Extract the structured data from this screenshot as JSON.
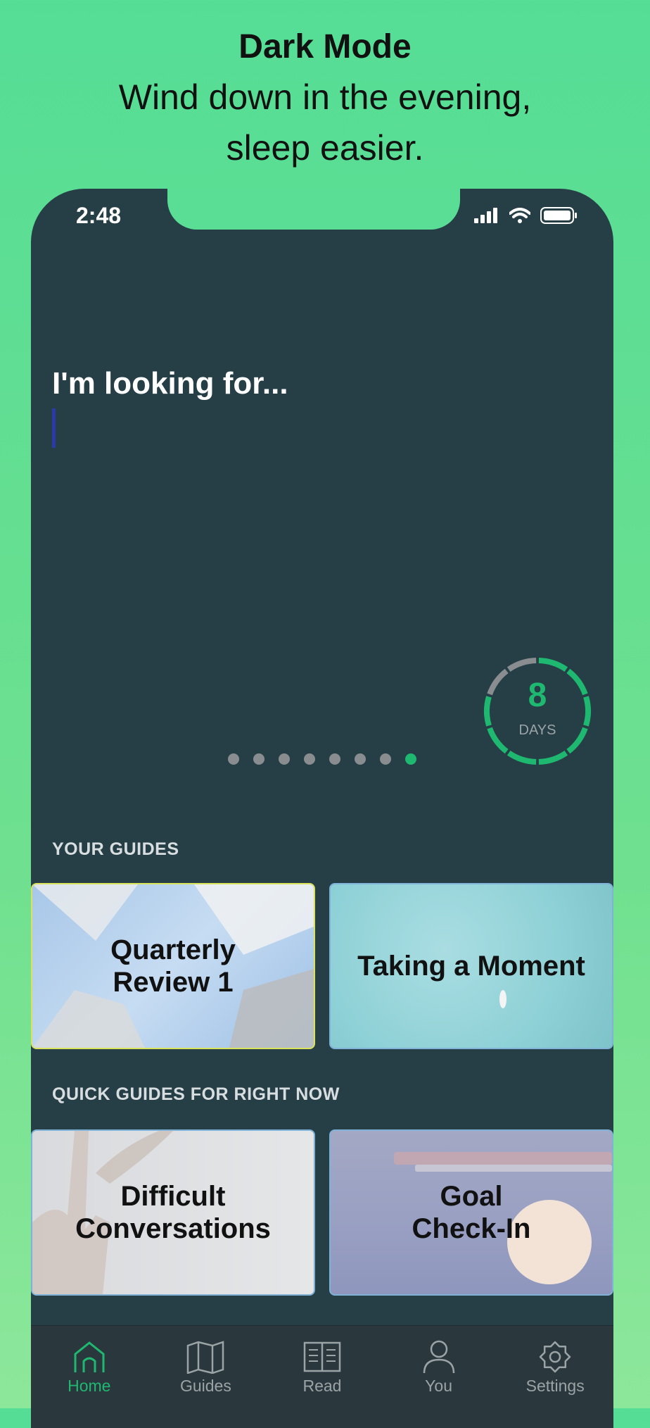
{
  "promo": {
    "title": "Dark Mode",
    "subtitle_line1": "Wind down in the evening,",
    "subtitle_line2": "sleep easier."
  },
  "status_bar": {
    "time": "2:48"
  },
  "search": {
    "prompt": "I'm looking for..."
  },
  "streak": {
    "count": "8",
    "label": "DAYS",
    "progress_fraction": 0.8
  },
  "carousel": {
    "page_count": 8,
    "active_index": 7
  },
  "your_guides": {
    "header": "YOUR GUIDES",
    "cards": [
      {
        "line1": "Quarterly",
        "line2": "Review 1"
      },
      {
        "line1": "Taking a Moment",
        "line2": ""
      }
    ]
  },
  "quick_guides": {
    "header": "QUICK GUIDES FOR RIGHT NOW",
    "cards": [
      {
        "line1": "Difficult",
        "line2": "Conversations"
      },
      {
        "line1": "Goal",
        "line2": "Check-In"
      }
    ]
  },
  "tabbar": {
    "items": [
      {
        "label": "Home",
        "icon": "home-icon",
        "active": true
      },
      {
        "label": "Guides",
        "icon": "map-icon",
        "active": false
      },
      {
        "label": "Read",
        "icon": "book-icon",
        "active": false
      },
      {
        "label": "You",
        "icon": "person-icon",
        "active": false
      },
      {
        "label": "Settings",
        "icon": "gear-icon",
        "active": false
      }
    ]
  },
  "colors": {
    "background": "#5ade95",
    "phone_bg": "#263f47",
    "accent": "#1eb870",
    "tabbar_bg": "#2a383e"
  }
}
